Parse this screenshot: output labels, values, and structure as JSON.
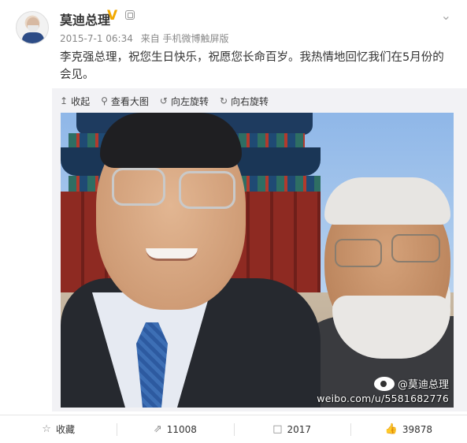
{
  "header": {
    "name": "莫迪总理",
    "verified_badge": "V",
    "timestamp": "2015-7-1 06:34",
    "source": "来自 手机微博触屏版",
    "menu_icon": "chevron-down-icon"
  },
  "post": {
    "text": "李克强总理，祝您生日快乐，祝愿您长命百岁。我热情地回忆我们在5月份的会见。"
  },
  "image_toolbar": {
    "collapse": "收起",
    "view_large": "查看大图",
    "rotate_left": "向左旋转",
    "rotate_right": "向右旋转"
  },
  "watermark": {
    "handle": "@莫迪总理",
    "url": "weibo.com/u/5581682776"
  },
  "footer": {
    "favorite": "收藏",
    "repost_count": "11008",
    "comment_count": "2017",
    "like_count": "39878"
  },
  "colors": {
    "verified": "#f2a900",
    "panel_bg": "#f2f2f5",
    "text": "#333333",
    "meta": "#888888"
  }
}
